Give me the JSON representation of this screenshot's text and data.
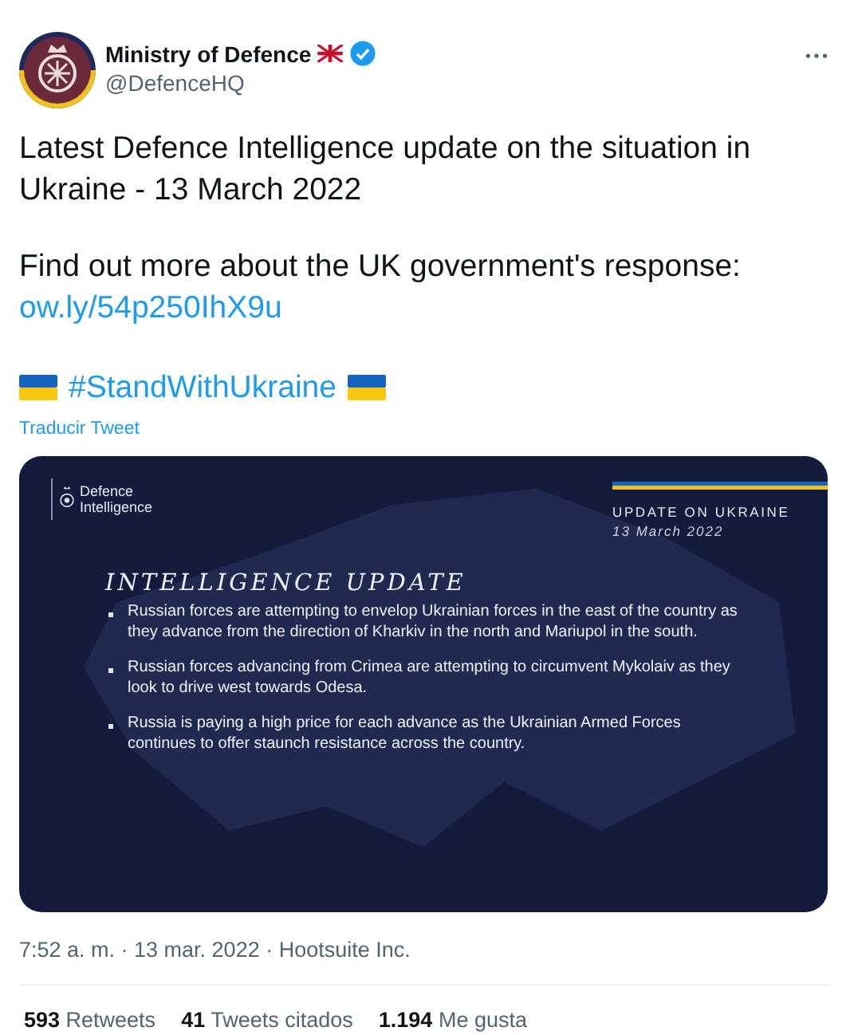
{
  "author": {
    "name": "Ministry of Defence",
    "handle": "@DefenceHQ",
    "verified": true
  },
  "text": [
    "Latest Defence Intelligence update on the situation in Ukraine - 13 March 2022",
    "Find out more about the UK government's response:"
  ],
  "link": "ow.ly/54p250IhX9u",
  "hashtag": "#StandWithUkraine",
  "translate": "Traducir Tweet",
  "card": {
    "logo_lines": [
      "Defence",
      "Intelligence"
    ],
    "banner": "UPDATE ON UKRAINE",
    "date": "13 March 2022",
    "heading": "INTELLIGENCE UPDATE",
    "bullets": [
      "Russian forces are attempting to envelop Ukrainian forces in the east of the country as they advance from the direction of Kharkiv in the north and Mariupol in the south.",
      "Russian forces advancing from Crimea are attempting to circumvent Mykolaiv as they look to drive west towards Odesa.",
      "Russia is paying a high price for each advance as the Ukrainian Armed Forces continues to offer staunch resistance across the country."
    ]
  },
  "meta": "7:52 a. m. · 13 mar. 2022 · Hootsuite Inc.",
  "stats": [
    {
      "count": "593",
      "label": "Retweets"
    },
    {
      "count": "41",
      "label": "Tweets citados"
    },
    {
      "count": "1.194",
      "label": "Me gusta"
    }
  ]
}
